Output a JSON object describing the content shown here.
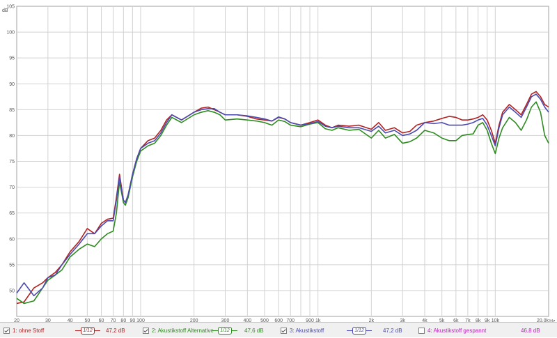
{
  "chart_data": {
    "type": "line",
    "title": "",
    "xlabel": "Hz",
    "ylabel": "dB",
    "xscale": "log",
    "xlim": [
      20,
      20000
    ],
    "ylim": [
      45,
      105
    ],
    "grid": true,
    "y_ticks": [
      50,
      55,
      60,
      65,
      70,
      75,
      80,
      85,
      90,
      95,
      100,
      105
    ],
    "y_tick_labels": [
      "50",
      "55",
      "60",
      "65",
      "70",
      "75",
      "80",
      "85",
      "90",
      "95",
      "100",
      "105"
    ],
    "x_ticks": [
      20,
      30,
      40,
      50,
      60,
      70,
      80,
      90,
      100,
      200,
      300,
      400,
      500,
      600,
      700,
      900,
      1000,
      2000,
      3000,
      4000,
      5000,
      6000,
      7000,
      8000,
      9000,
      10000,
      20000
    ],
    "x_tick_labels": [
      "20",
      "30",
      "40",
      "50",
      "60",
      "70",
      "80",
      "90",
      "100",
      "200",
      "300",
      "400",
      "500",
      "600",
      "700",
      "900",
      "1k",
      "2k",
      "3k",
      "4k",
      "5k",
      "6k",
      "7k",
      "8k",
      "9k",
      "10k",
      "20,0k"
    ],
    "series": [
      {
        "name": "1: ohne Stoff",
        "color": "#b22222",
        "x": [
          20,
          22,
          25,
          28,
          30,
          33,
          36,
          40,
          45,
          50,
          55,
          60,
          65,
          70,
          73,
          76,
          78,
          80,
          82,
          85,
          90,
          95,
          100,
          110,
          120,
          130,
          140,
          150,
          170,
          200,
          220,
          240,
          260,
          280,
          300,
          350,
          400,
          450,
          500,
          550,
          600,
          650,
          700,
          800,
          900,
          1000,
          1100,
          1200,
          1300,
          1500,
          1700,
          2000,
          2200,
          2400,
          2700,
          3000,
          3300,
          3600,
          4000,
          4500,
          5000,
          5500,
          6000,
          6500,
          7000,
          7500,
          8000,
          8500,
          9000,
          9500,
          10000,
          10500,
          11000,
          12000,
          13000,
          14000,
          15000,
          16000,
          17000,
          18000,
          19000,
          20000
        ],
        "values": [
          47.5,
          47.8,
          50.5,
          51.5,
          52.5,
          53.5,
          55,
          57.5,
          59.5,
          62,
          61,
          63,
          63.8,
          64,
          68,
          72.5,
          70,
          67.5,
          67,
          68.5,
          72.5,
          75.5,
          77.5,
          79,
          79.5,
          81,
          83,
          84,
          83,
          84.5,
          85.3,
          85.5,
          85,
          84.5,
          84,
          84,
          83.7,
          83.2,
          83,
          82.8,
          83.5,
          83.2,
          82.5,
          82,
          82.5,
          83,
          82,
          81.5,
          82,
          81.8,
          82,
          81.2,
          82.5,
          81,
          81.5,
          80.5,
          80.8,
          82,
          82.5,
          82.8,
          83.3,
          83.7,
          83.5,
          83,
          83,
          83.2,
          83.5,
          84,
          83,
          81,
          78.5,
          82,
          84.5,
          86,
          85,
          84,
          86,
          88,
          88.5,
          87.5,
          86,
          85.5
        ]
      },
      {
        "name": "2: Akustikstoff Alternative",
        "color": "#2e8b20",
        "x": [
          20,
          22,
          25,
          28,
          30,
          33,
          36,
          40,
          45,
          50,
          55,
          60,
          65,
          70,
          73,
          76,
          78,
          80,
          82,
          85,
          90,
          95,
          100,
          110,
          120,
          130,
          140,
          150,
          170,
          200,
          220,
          240,
          260,
          280,
          300,
          350,
          400,
          450,
          500,
          550,
          600,
          650,
          700,
          800,
          900,
          1000,
          1100,
          1200,
          1300,
          1500,
          1700,
          2000,
          2200,
          2400,
          2700,
          3000,
          3300,
          3600,
          4000,
          4500,
          5000,
          5500,
          6000,
          6500,
          7000,
          7500,
          8000,
          8500,
          9000,
          9500,
          10000,
          10500,
          11000,
          12000,
          13000,
          14000,
          15000,
          16000,
          17000,
          18000,
          19000,
          20000
        ],
        "values": [
          48.5,
          47.5,
          48,
          50.5,
          52,
          53,
          54,
          56.5,
          58,
          59,
          58.5,
          60,
          61,
          61.5,
          65,
          71,
          69,
          67,
          66.5,
          68,
          72,
          75,
          77,
          78,
          78.5,
          80,
          82,
          83.5,
          82.5,
          84,
          84.5,
          84.8,
          84.5,
          84,
          83,
          83.2,
          83,
          82.8,
          82.5,
          82,
          83,
          82.7,
          82,
          81.7,
          82.2,
          82.5,
          81.3,
          81,
          81.5,
          81,
          81.2,
          79.5,
          81,
          79.5,
          80.2,
          78.5,
          78.8,
          79.5,
          81,
          80.5,
          79.5,
          79,
          79,
          80,
          80.2,
          80.3,
          82,
          82.5,
          81,
          78.5,
          76.5,
          79.5,
          81.5,
          83.5,
          82.5,
          81,
          83,
          85.5,
          86.5,
          84.5,
          80,
          78.5
        ]
      },
      {
        "name": "3: Akustikstoff",
        "color": "#4a4ab0",
        "x": [
          20,
          22,
          25,
          28,
          30,
          33,
          36,
          40,
          45,
          50,
          55,
          60,
          65,
          70,
          73,
          76,
          78,
          80,
          82,
          85,
          90,
          95,
          100,
          110,
          120,
          130,
          140,
          150,
          170,
          200,
          220,
          240,
          260,
          280,
          300,
          350,
          400,
          450,
          500,
          550,
          600,
          650,
          700,
          800,
          900,
          1000,
          1100,
          1200,
          1300,
          1500,
          1700,
          2000,
          2200,
          2400,
          2700,
          3000,
          3300,
          3600,
          4000,
          4500,
          5000,
          5500,
          6000,
          6500,
          7000,
          7500,
          8000,
          8500,
          9000,
          9500,
          10000,
          10500,
          11000,
          12000,
          13000,
          14000,
          15000,
          16000,
          17000,
          18000,
          19000,
          20000
        ],
        "values": [
          49.5,
          51.5,
          49,
          50.5,
          52.5,
          53,
          55,
          57,
          59,
          61,
          61,
          62.5,
          63.5,
          63.5,
          67.5,
          72,
          69.5,
          67.5,
          67,
          68.5,
          72.5,
          75.5,
          77.5,
          78.5,
          79,
          80.5,
          82.5,
          84,
          83,
          84.5,
          85,
          85.2,
          85.2,
          84.5,
          84,
          84,
          83.8,
          83.5,
          83.2,
          82.8,
          83.6,
          83.2,
          82.5,
          82,
          82.3,
          82.7,
          81.8,
          81.5,
          81.8,
          81.5,
          81.5,
          80.8,
          81.8,
          80.5,
          81,
          80,
          80.3,
          81,
          82.5,
          82.3,
          82.5,
          82,
          82,
          82,
          82.2,
          82.5,
          83,
          83.3,
          82,
          80,
          78,
          81.5,
          84,
          85.5,
          84.5,
          83.5,
          85.5,
          87.5,
          88,
          87,
          85.5,
          84.5
        ]
      }
    ],
    "legend": {
      "position": "bottom",
      "entries": [
        {
          "label": "1: ohne Stoff",
          "checked": true,
          "smoothing": "1/12",
          "value": "47,2 dB",
          "color": "#b22222"
        },
        {
          "label": "2: Akustikstoff Alternative",
          "checked": true,
          "smoothing": "1/12",
          "value": "47,6 dB",
          "color": "#2e8b20"
        },
        {
          "label": "3: Akustikstoff",
          "checked": true,
          "smoothing": "1/12",
          "value": "47,2 dB",
          "color": "#4a4ab0"
        },
        {
          "label": "4: Akustikstoff gespannt",
          "checked": false,
          "smoothing": "",
          "value": "46,8 dB",
          "color": "#c020c0"
        }
      ]
    }
  }
}
